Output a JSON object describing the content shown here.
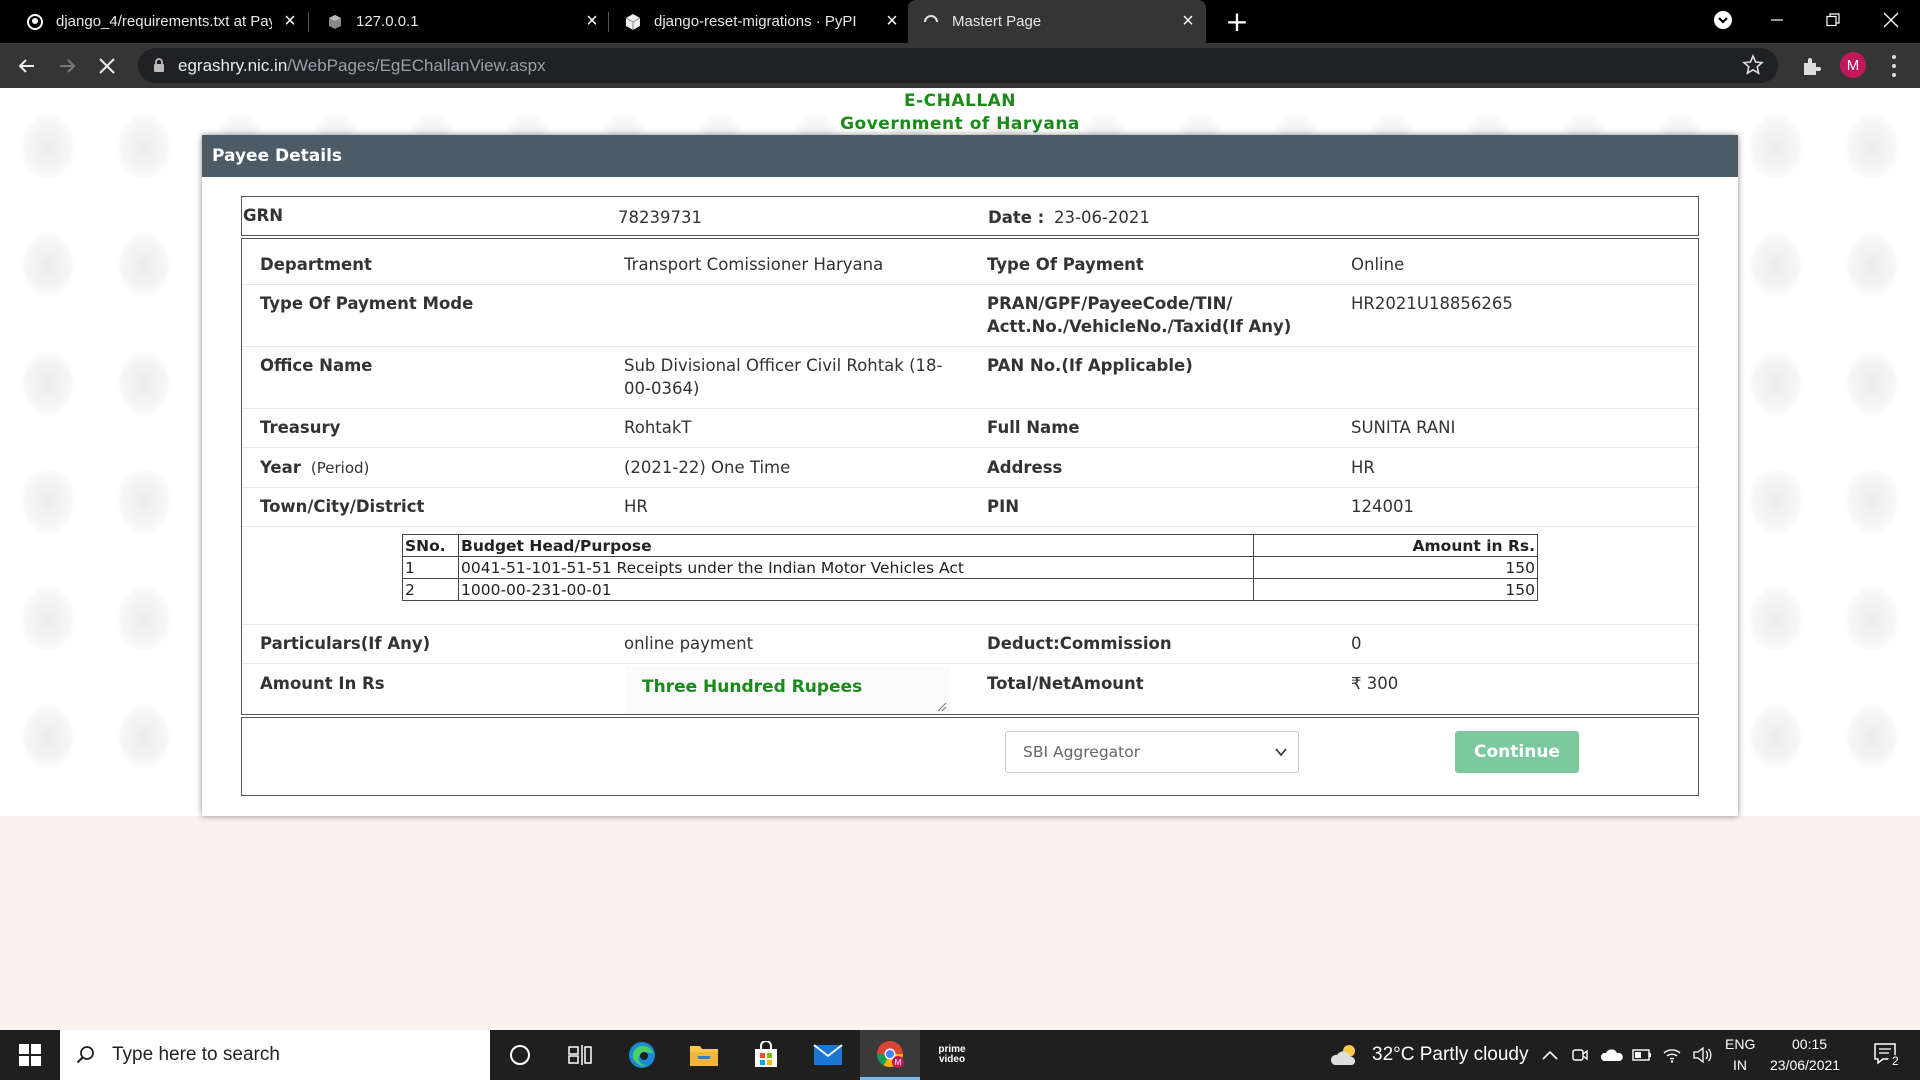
{
  "browser": {
    "tabs": [
      {
        "title": "django_4/requirements.txt at Pay",
        "icon": "github-icon"
      },
      {
        "title": "127.0.0.1",
        "icon": "cube-icon"
      },
      {
        "title": "django-reset-migrations · PyPI",
        "icon": "pypi-icon"
      },
      {
        "title": "Mastert Page",
        "icon": "loading-icon",
        "active": true
      }
    ],
    "url_host": "egrashry.nic.in",
    "url_path": "/WebPages/EgEChallanView.aspx",
    "profile_initial": "M"
  },
  "header": {
    "line1": "E-CHALLAN",
    "line2": "Government of Haryana"
  },
  "card": {
    "title": "Payee Details",
    "grn_label": "GRN",
    "grn_value": "78239731",
    "date_label": "Date :",
    "date_value": "23-06-2021"
  },
  "details": {
    "department_label": "Department",
    "department_value": "Transport Comissioner Haryana",
    "payment_type_label": "Type Of Payment",
    "payment_type_value": "Online",
    "payment_mode_label": "Type Of Payment Mode",
    "payment_mode_value": "",
    "pran_label_line1": "PRAN/GPF/PayeeCode/TIN/",
    "pran_label_line2": "Actt.No./VehicleNo./Taxid(If Any)",
    "pran_value": "HR2021U18856265",
    "office_label": "Office Name",
    "office_value_line1": "Sub Divisional Officer Civil Rohtak (18-",
    "office_value_line2": "00-0364)",
    "pan_label": "PAN No.(If Applicable)",
    "pan_value": "",
    "treasury_label": "Treasury",
    "treasury_value": "RohtakT",
    "fullname_label": "Full Name",
    "fullname_value": "SUNITA RANI",
    "year_label": "Year",
    "year_sub": "(Period)",
    "year_value": "(2021-22) One Time",
    "address_label": "Address",
    "address_value": "HR",
    "town_label": "Town/City/District",
    "town_value": "HR",
    "pin_label": "PIN",
    "pin_value": "124001",
    "particulars_label": "Particulars(If Any)",
    "particulars_value": "online payment",
    "commission_label": "Deduct:Commission",
    "commission_value": "0",
    "amount_label": "Amount In Rs",
    "amount_words": "Three Hundred Rupees",
    "total_label": "Total/NetAmount",
    "total_value": "₹ 300"
  },
  "budget": {
    "headers": [
      "SNo.",
      "Budget Head/Purpose",
      "Amount in Rs."
    ],
    "rows": [
      [
        "1",
        "0041-51-101-51-51 Receipts under the Indian Motor Vehicles Act",
        "150"
      ],
      [
        "2",
        "1000-00-231-00-01",
        "150"
      ]
    ]
  },
  "footer": {
    "aggregator_selected": "SBI Aggregator",
    "continue_label": "Continue"
  },
  "taskbar": {
    "search_placeholder": "Type here to search",
    "weather": "32°C  Partly cloudy",
    "lang_line1": "ENG",
    "lang_line2": "IN",
    "time": "00:15",
    "date": "23/06/2021",
    "notification_count": "2",
    "prime_text": "prime video"
  },
  "colors": {
    "header_green": "#1a8a1a",
    "card_header": "#4c5b66",
    "continue_button": "#7cc9a0",
    "avatar": "#c2185b"
  }
}
